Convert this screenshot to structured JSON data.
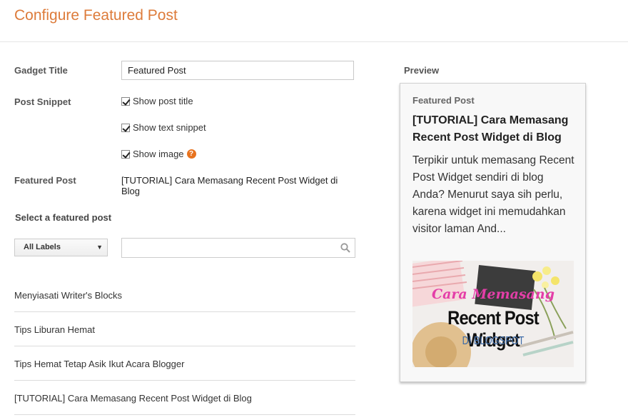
{
  "header": {
    "title": "Configure Featured Post"
  },
  "form": {
    "gadget_title_label": "Gadget Title",
    "gadget_title_value": "Featured Post",
    "post_snippet_label": "Post Snippet",
    "options": [
      {
        "label": "Show post title",
        "checked": true
      },
      {
        "label": "Show text snippet",
        "checked": true
      },
      {
        "label": "Show image",
        "checked": true
      }
    ],
    "help_glyph": "?",
    "featured_post_label": "Featured Post",
    "featured_post_value": "[TUTORIAL] Cara Memasang Recent Post Widget di Blog",
    "select_label": "Select a featured post",
    "labels_dropdown": "All Labels",
    "search_placeholder": ""
  },
  "posts": [
    "Menyiasati Writer's Blocks",
    "Tips Liburan Hemat",
    "Tips Hemat Tetap Asik Ikut Acara Blogger",
    "[TUTORIAL] Cara Memasang Recent Post Widget di Blog"
  ],
  "preview": {
    "label": "Preview",
    "widget_title": "Featured Post",
    "post_title": "[TUTORIAL] Cara Memasang Recent Post Widget di Blog",
    "snippet": "Terpikir untuk memasang Recent Post Widget sendiri di blog Anda? Menurut saya sih perlu, karena widget ini memudahkan visitor laman And...",
    "image": {
      "line1": "Cara Memasang",
      "line2": "Recent Post Widget",
      "line3": "DI BLOGSPOT"
    }
  },
  "colors": {
    "accent": "#dd7b3a",
    "help": "#e8731f",
    "image_pink": "#e43ea8",
    "image_blue": "#3d6ba8"
  }
}
